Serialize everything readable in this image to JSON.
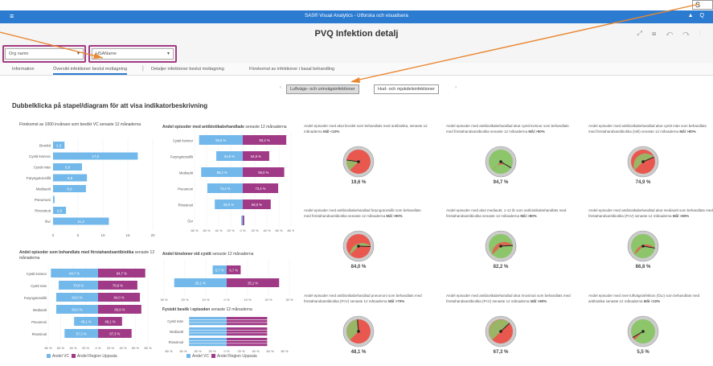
{
  "header": {
    "menu_icon": "menu-icon",
    "app_title": "SAS® Visual Analytics - Utforska och visualisera",
    "tools": "▲ Q",
    "callout": "S"
  },
  "report": {
    "title": "PVQ Infektion detalj",
    "icons": "⤢ ⊞ ↶ ↷ ⋮"
  },
  "filters": {
    "org_placeholder": "Org namn",
    "hsa_placeholder": "HSAName"
  },
  "tabs": [
    "Information",
    "Översikt infektioner beslut mottagning",
    "Detaljer infektioner beslut mottagning",
    "Förekomst av infektioner i basal behandling"
  ],
  "subtabs": [
    "Luftvägs- och urinvägsinfektioner",
    "Hud- och mjukdelsinfektioner"
  ],
  "heading": "Dubbelklicka på stapel/diagram för att visa indikatorbeskrivning",
  "colors": {
    "blue": "#73b8ea",
    "purple": "#a03a86",
    "red": "#e8584f",
    "green": "#8cc56a",
    "accent": "#2b7bd1",
    "highlight": "#a33b83",
    "arrow": "#e98732"
  },
  "chart1": {
    "title": "Förekomst av 1000 invånare som besökt VC senaste 12 månaderna",
    "categories": [
      "Bronkit",
      "Cystit kvinnor",
      "Cystit män",
      "Faryngotonsillit",
      "Mediaotit",
      "Pneumoni",
      "Rinosinuit",
      "Övr"
    ],
    "values": [
      2.3,
      17.0,
      5.8,
      6.8,
      6.6,
      0.3,
      2.6,
      11.2
    ],
    "labels": [
      "2,3",
      "17,0",
      "5,8",
      "6,8",
      "6,6",
      "0,3",
      "2,6",
      "11,2"
    ],
    "ticks": [
      "0",
      "5",
      "10",
      "15",
      "20"
    ],
    "xlim": [
      0,
      20
    ]
  },
  "chart2": {
    "title": "Andel episoder med antibiotikabehandlade",
    "title_suffix": "senaste 12 månaderna",
    "categories": [
      "Cystit kvinnor",
      "Faryngotonsillit",
      "Mediaotit",
      "Pneumoni",
      "Rinosinuit",
      "Övr"
    ],
    "left": [
      90.6,
      54.9,
      86.2,
      73.4,
      58.0,
      3.0
    ],
    "right": [
      90.2,
      54.9,
      86.0,
      73.4,
      58.0,
      3.0
    ],
    "left_labels": [
      "90,6 %",
      "54,9 %",
      "86,2 %",
      "73,4 %",
      "58,0 %",
      ""
    ],
    "right_labels": [
      "90,2 %",
      "54,9 %",
      "86,0 %",
      "73,4 %",
      "58,0 %",
      ""
    ],
    "ticks": [
      "80 %",
      "60 %",
      "40 %",
      "20 %",
      "0 %",
      "20 %",
      "40 %",
      "60 %",
      "80 %"
    ]
  },
  "chart3": {
    "title": "Andel episoder som behandlats med förstahandsantibiotika",
    "title_suffix": "senaste 12 månaderna",
    "categories": [
      "Cystit kvinnor",
      "Cystit män",
      "Faryngotonsillit",
      "Mediaotit",
      "Pneumoni",
      "Rinosinuit"
    ],
    "left": [
      94.7,
      78.9,
      84.0,
      84.0,
      48.1,
      67.3
    ],
    "right": [
      94.7,
      78.9,
      84.0,
      86.8,
      48.1,
      67.3
    ],
    "left_labels": [
      "94,7 %",
      "78,9 %",
      "84,0 %",
      "84,0 %",
      "48,1 %",
      "67,3 %"
    ],
    "right_labels": [
      "94,7 %",
      "78,9 %",
      "84,0 %",
      "86,8 %",
      "48,1 %",
      "67,3 %"
    ],
    "ticks": [
      "80 %",
      "60 %",
      "40 %",
      "20 %",
      "0 %",
      "20 %",
      "40 %",
      "60 %",
      "80 %"
    ]
  },
  "chart4": {
    "title": "Andel kinoloner vid cystit",
    "title_suffix": "senaste 12 månaderna",
    "left": [
      6.7,
      25.1
    ],
    "right": [
      6.7,
      25.1
    ],
    "left_labels": [
      "6,7 %",
      "25,1 %"
    ],
    "right_labels": [
      "6,7 %",
      "25,1 %"
    ],
    "ticks": [
      "30 %",
      "20 %",
      "10 %",
      "0 %",
      "10 %",
      "20 %",
      "30 %"
    ]
  },
  "chart5": {
    "title": "Fysiskt besök i episoden",
    "title_suffix": "senaste 12 månaderna",
    "categories": [
      "Cystit män",
      "Mediaotit",
      "Rinosinuit"
    ],
    "ticks": [
      "80 %",
      "60 %",
      "40 %",
      "20 %",
      "0 %",
      "20 %",
      "40 %",
      "60 %",
      "80 %"
    ]
  },
  "legend": {
    "vc": "Andel VC",
    "region": "Andel Region Uppsala"
  },
  "gauges": [
    {
      "cap": "Andel episoder med akut bronkit som behandlats med antibiotika, senaste 12 månaderna",
      "goal": "Mål <10%",
      "value": 19.6,
      "label": "19,6 %",
      "good": false
    },
    {
      "cap": "Andel episoder med antibiotikabehandlad akut cystit kvinnor som behandlats med förstahandsantibiotika senaste 12 månaderna",
      "goal": "Mål >90%",
      "value": 94.7,
      "label": "94,7 %",
      "good": true
    },
    {
      "cap": "Andel episoder med antibiotikabehandlad akut cystit män som behandlats med förstahandsantibiotika (inkl) senaste 12 månaderna",
      "goal": "Mål >80%",
      "value": 74.9,
      "label": "74,9 %",
      "good": false
    },
    {
      "cap": "Andel episoder med antibiotikabehandlad faryngotonsillit som behandlats med förstahandsantibiotika senaste 12 månaderna",
      "goal": "Mål >90%",
      "value": 84.0,
      "label": "84,0 %",
      "good": false
    },
    {
      "cap": "Andel episoder med akut mediaotit, 1-12 år som antibiotikabehandlats med förstahandsantibiotika senaste 12 månaderna",
      "goal": "Mål >80%",
      "value": 82.2,
      "label": "82,2 %",
      "good": true
    },
    {
      "cap": "Andel episoder med antibiotikabehandlad akut mediaotit som behandlats med förstahandsantibiotika (PcV) senaste 12 månaderna",
      "goal": "Mål >80%",
      "value": 86.8,
      "label": "86,8 %",
      "good": true
    },
    {
      "cap": "Andel episoder med antibiotikabehandlad pneumoni som behandlats med förstahandsantibiotika (PcV) senaste 12 månaderna",
      "goal": "Mål >70%",
      "value": 48.1,
      "label": "48,1 %",
      "good": false
    },
    {
      "cap": "Andel episoder med antibiotikabehandlad akut rinosinuit som behandlats med förstahandsantibiotika (PcV) senaste 12 månaderna",
      "goal": "Mål >80%",
      "value": 67.3,
      "label": "67,3 %",
      "good": false
    },
    {
      "cap": "Andel episoder med övre luftvägsinfektion (ÖLI) som behandlats med antibiotika senaste 12 månaderna",
      "goal": "Mål <10%",
      "value": 5.5,
      "label": "5,5 %",
      "good": true
    }
  ]
}
